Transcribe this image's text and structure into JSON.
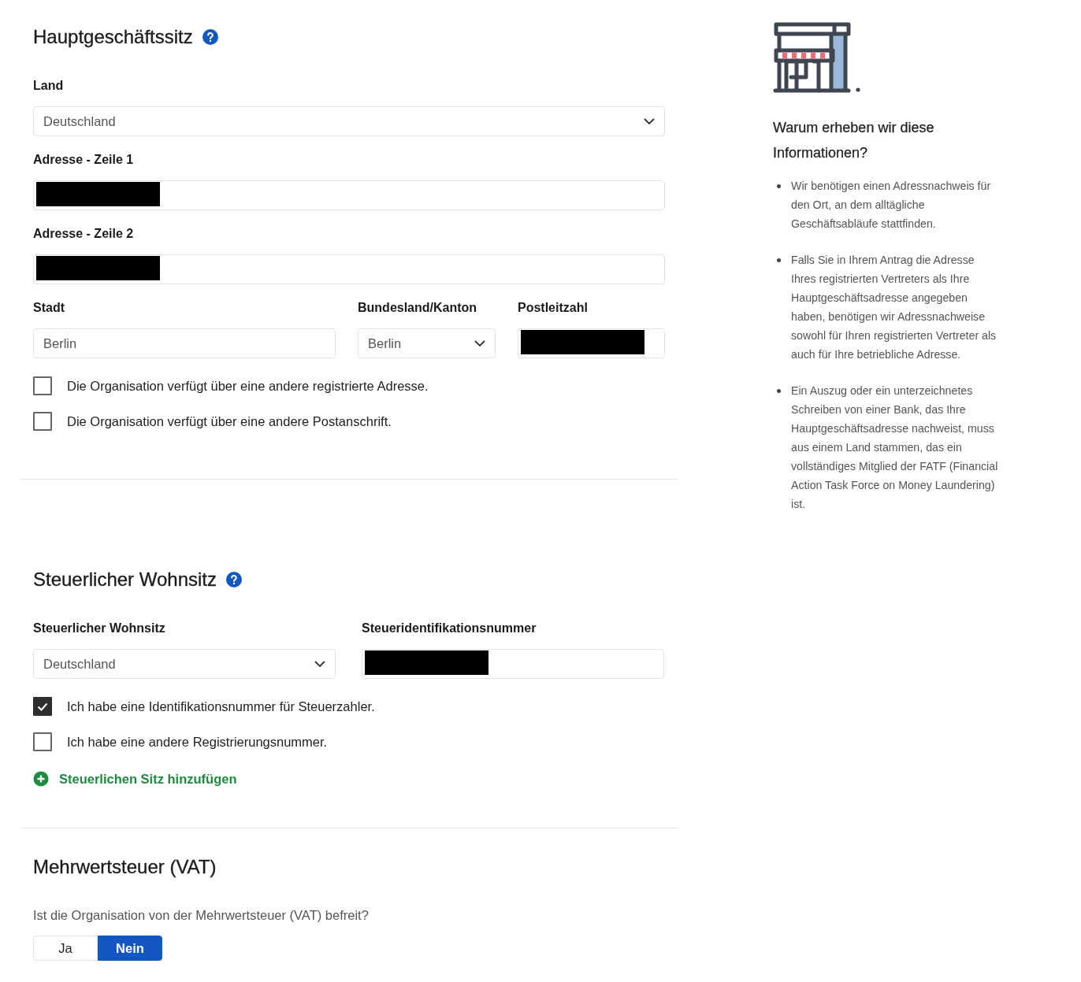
{
  "sections": [
    {
      "title": "Hauptgeschäftssitz",
      "help": true,
      "rows": [
        [
          {
            "kind": "select",
            "label": "Land",
            "value": "Deutschland"
          }
        ],
        [
          {
            "kind": "text",
            "label": "Adresse - Zeile 1",
            "redacted": true
          }
        ],
        [
          {
            "kind": "text",
            "label": "Adresse - Zeile 2",
            "redacted": true
          }
        ],
        [
          {
            "kind": "text",
            "label": "Stadt",
            "value": "Berlin"
          },
          {
            "kind": "select",
            "label": "Bundesland/Kanton",
            "value": "Berlin"
          },
          {
            "kind": "text",
            "label": "Postleitzahl",
            "redacted": true
          }
        ]
      ],
      "checkboxes": [
        {
          "label": "Die Organisation verfügt über eine andere registrierte Adresse.",
          "checked": false
        },
        {
          "label": "Die Organisation verfügt über eine andere Postanschrift.",
          "checked": false
        }
      ]
    },
    {
      "title": "Steuerlicher Wohnsitz",
      "help": true,
      "rows": [
        [
          {
            "kind": "select",
            "label": "Steuerlicher Wohnsitz",
            "value": "Deutschland"
          },
          {
            "kind": "text",
            "label": "Steueridentifikationsnummer",
            "redacted": true
          }
        ]
      ],
      "checkboxes": [
        {
          "label": "Ich habe eine Identifikationsnummer für Steuerzahler.",
          "checked": true
        },
        {
          "label": "Ich habe eine andere Registrierungsnummer.",
          "checked": false
        }
      ],
      "add_link": "Steuerlichen Sitz hinzufügen"
    },
    {
      "title": "Mehrwertsteuer (VAT)",
      "help": false,
      "question": "Ist die Organisation von der Mehrwertsteuer (VAT) befreit?",
      "toggle": [
        {
          "label": "Ja",
          "selected": false
        },
        {
          "label": "Nein",
          "selected": true
        }
      ]
    }
  ],
  "info": {
    "title": "Warum erheben wir diese Informationen?",
    "bullets": [
      "Wir benötigen einen Adressnachweis für den Ort, an dem alltägliche Geschäftsabläufe stattfinden.",
      "Falls Sie in Ihrem Antrag die Adresse Ihres registrierten Vertreters als Ihre Hauptgeschäftsadresse angegeben haben, benötigen wir Adressnachweise sowohl für Ihren registrierten Vertreter als auch für Ihre betriebliche Adresse.",
      "Ein Auszug oder ein unterzeichnetes Schreiben von einer Bank, das Ihre Hauptgeschäftsadresse nachweist, muss aus einem Land stammen, das ein vollständiges Mitglied der FATF (Financial Action Task Force on Money Laundering) ist."
    ]
  }
}
